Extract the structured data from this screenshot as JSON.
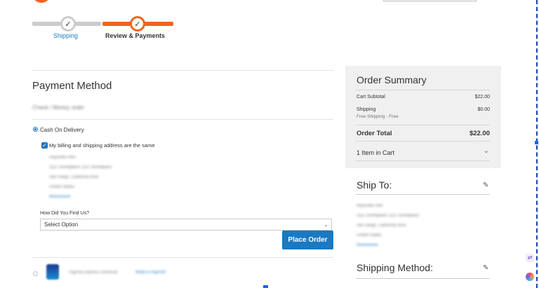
{
  "progress": {
    "steps": [
      {
        "label": "Shipping",
        "state": "completed",
        "icon": "check-icon"
      },
      {
        "label": "Review & Payments",
        "state": "active",
        "icon": "check-icon"
      }
    ],
    "active_color": "#f26322",
    "inactive_color": "#cccccc"
  },
  "payment": {
    "title": "Payment Method",
    "blurred_option": "Check / Money order",
    "cod_label": "Cash On Delivery",
    "same_address_label": "My billing and shipping address are the same",
    "address_lines": [
      "Reynolds Ren",
      "1111 Someplace 1111 Someplace",
      "San Diego, California 9xxx",
      "United States",
      "9xxxxxxxxx"
    ],
    "find_us_label": "How Did You Find Us?",
    "select_value": "Select Option",
    "place_order_label": "Place Order",
    "paypal_text": "PayPal Express Checkout",
    "paypal_link": "What is PayPal?"
  },
  "summary": {
    "title": "Order Summary",
    "cart_subtotal_label": "Cart Subtotal",
    "cart_subtotal_value": "$22.00",
    "shipping_label": "Shipping",
    "shipping_value": "$0.00",
    "shipping_sub": "Free Shipping - Free",
    "total_label": "Order Total",
    "total_value": "$22.00",
    "items_in_cart": "1 Item in Cart"
  },
  "ship_to": {
    "title": "Ship To:",
    "address_lines": [
      "Reynolds Ren",
      "1111 Someplace 1111 Someplace",
      "San Diego, California 9xxx",
      "United States",
      "9xxxxxxxxx"
    ]
  },
  "shipping_method": {
    "title": "Shipping Method:"
  },
  "accent_blue": "#1979c3"
}
